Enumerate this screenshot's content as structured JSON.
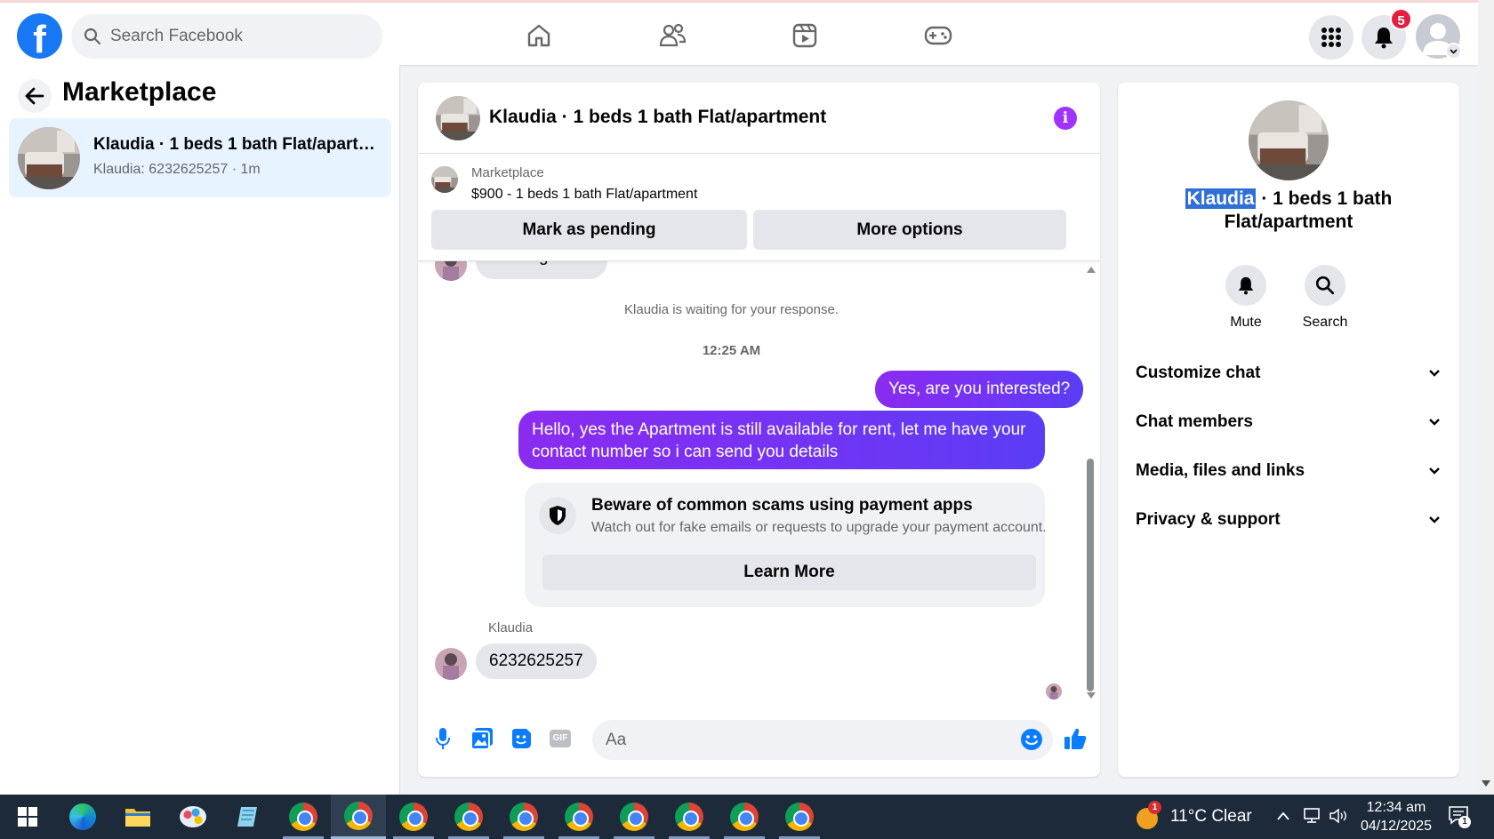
{
  "topbar": {
    "logo_letter": "f",
    "search_placeholder": "Search Facebook",
    "nav_icons": [
      "home-icon",
      "friends-icon",
      "watch-icon",
      "gaming-icon"
    ],
    "notification_count": "5"
  },
  "sidebar": {
    "title": "Marketplace",
    "conversation": {
      "title": "Klaudia · 1 beds 1 bath Flat/apartment",
      "subtitle": "Klaudia: 6232625257 · 1m"
    }
  },
  "chat": {
    "header_title": "Klaudia · 1 beds 1 bath Flat/apartment",
    "info_label": "i",
    "listing": {
      "label": "Marketplace",
      "price_line": "$900 - 1 beds 1 bath Flat/apartment"
    },
    "buttons": {
      "mark_pending": "Mark as pending",
      "more_options": "More options"
    },
    "messages": {
      "partial_top": "Message sent",
      "waiting": "Klaudia is waiting for your response.",
      "timestamp": "12:25 AM",
      "out_1": "Yes, are you interested?",
      "out_2": "Hello, yes the Apartment is still available for rent, let me have your contact number so i can send you details",
      "scam_title": "Beware of common scams using payment apps",
      "scam_subtitle": "Watch out for fake emails or requests to upgrade your payment account.",
      "learn_more": "Learn More",
      "sender_name": "Klaudia",
      "in_1": "6232625257"
    },
    "composer": {
      "placeholder": "Aa",
      "icons": [
        "microphone-icon",
        "photo-icon",
        "sticker-icon",
        "gif-icon",
        "emoji-icon",
        "like-icon"
      ],
      "gif_label": "GIF"
    }
  },
  "details": {
    "name_selected": "Klaudia",
    "name_rest": "· 1 beds 1 bath Flat/apartment",
    "actions": {
      "mute": "Mute",
      "search": "Search"
    },
    "sections": [
      "Customize chat",
      "Chat members",
      "Media, files and links",
      "Privacy & support"
    ]
  },
  "taskbar": {
    "weather": "11°C  Clear",
    "weather_badge": "1",
    "time": "12:34 am",
    "date": "04/12/2025",
    "notification_badge": "1"
  },
  "colors": {
    "fb_blue": "#1877f2",
    "messenger_purple": "#7035f5",
    "selected_conversation": "#e7f3ff",
    "taskbar": "#1c2a3a"
  }
}
